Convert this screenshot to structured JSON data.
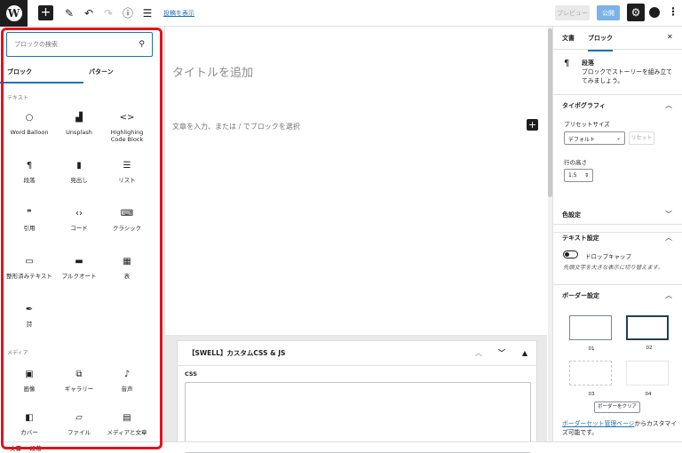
{
  "topbar": {
    "logo": "W",
    "show_post": "投稿を表示",
    "preview": "プレビュー",
    "publish": "公開"
  },
  "inserter": {
    "search_placeholder": "ブロックの検索",
    "tabs": [
      "ブロック",
      "パターン"
    ],
    "sections": [
      {
        "label": "テキスト",
        "items": [
          {
            "label": "Word Balloon",
            "icon": "speech-bubble-icon",
            "glyph": "○"
          },
          {
            "label": "Unsplash",
            "icon": "unsplash-icon",
            "glyph": "▟"
          },
          {
            "label": "Highlighing Code Block",
            "icon": "code-block-icon",
            "glyph": "<>"
          },
          {
            "label": "段落",
            "icon": "paragraph-icon",
            "glyph": "¶"
          },
          {
            "label": "見出し",
            "icon": "bookmark-icon",
            "glyph": "▮"
          },
          {
            "label": "リスト",
            "icon": "list-icon",
            "glyph": "☰"
          },
          {
            "label": "引用",
            "icon": "quote-icon",
            "glyph": "❞"
          },
          {
            "label": "コード",
            "icon": "code-icon",
            "glyph": "‹›"
          },
          {
            "label": "クラシック",
            "icon": "keyboard-icon",
            "glyph": "⌨"
          },
          {
            "label": "整形済みテキスト",
            "icon": "preformatted-icon",
            "glyph": "▭"
          },
          {
            "label": "プルクオート",
            "icon": "pullquote-icon",
            "glyph": "▬"
          },
          {
            "label": "表",
            "icon": "table-icon",
            "glyph": "▦"
          },
          {
            "label": "詩",
            "icon": "feather-icon",
            "glyph": "✒"
          }
        ]
      },
      {
        "label": "メディア",
        "items": [
          {
            "label": "画像",
            "icon": "image-icon",
            "glyph": "▣"
          },
          {
            "label": "ギャラリー",
            "icon": "gallery-icon",
            "glyph": "⧉"
          },
          {
            "label": "音声",
            "icon": "music-note-icon",
            "glyph": "♪"
          },
          {
            "label": "カバー",
            "icon": "cover-icon",
            "glyph": "◧"
          },
          {
            "label": "ファイル",
            "icon": "folder-icon",
            "glyph": "▱"
          },
          {
            "label": "メディアと文章",
            "icon": "media-text-icon",
            "glyph": "▤"
          }
        ]
      }
    ]
  },
  "editor": {
    "title_placeholder": "タイトルを追加",
    "paragraph_placeholder": "文章を入力、または / でブロックを選択"
  },
  "metabox": {
    "title": "【SWELL】カスタムCSS & JS",
    "css_label": "CSS"
  },
  "sidebar": {
    "tabs": [
      "文書",
      "ブロック"
    ],
    "block_name": "段落",
    "block_desc": "ブロックでストーリーを組み立ててみましょう。",
    "typography": "タイポグラフィ",
    "preset_size_label": "プリセットサイズ",
    "preset_size_value": "デフォルト",
    "reset": "リセット",
    "line_height_label": "行の高さ",
    "line_height_value": "1.5",
    "color_settings": "色設定",
    "text_settings": "テキスト設定",
    "drop_cap": "ドロップキャップ",
    "drop_cap_desc": "先頭文字を大きな表示に切り替えます。",
    "border_settings": "ボーダー設定",
    "border_options": [
      "01",
      "02",
      "03",
      "04"
    ],
    "border_clear": "ボーダーをクリア",
    "mgmt_link": "ボーダーセット管理ページ",
    "mgmt_text": "からカスタマイズ可能です。"
  },
  "breadcrumb": "文書 → 段落",
  "colors": {
    "accent": "#2271b1",
    "highlight": "#e0141e"
  }
}
